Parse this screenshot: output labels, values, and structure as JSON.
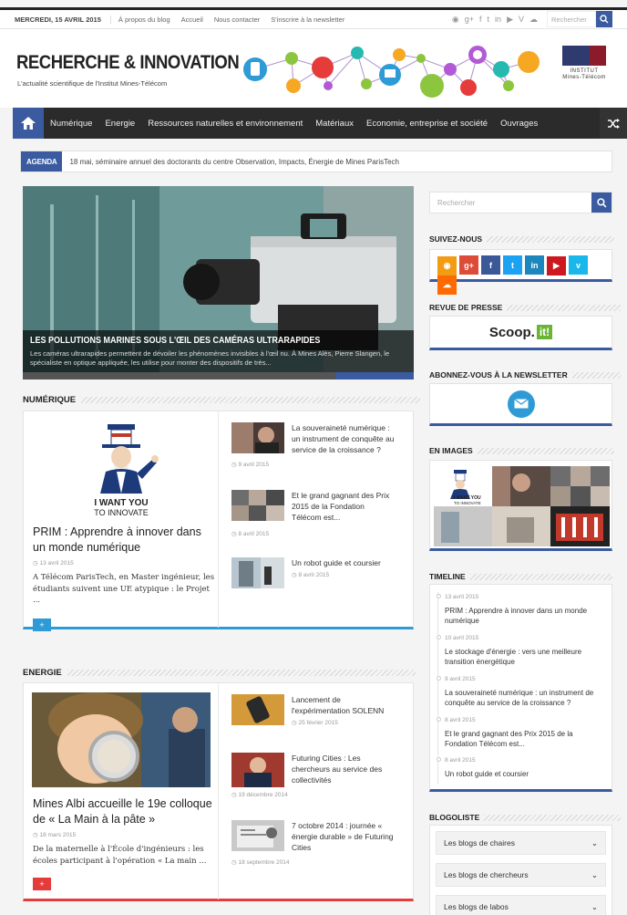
{
  "topbar": {
    "date": "MERCREDI, 15 AVRIL 2015",
    "links": [
      "À propos du blog",
      "Accueil",
      "Nous contacter",
      "S'inscrire à la newsletter"
    ],
    "search_placeholder": "Rechercher"
  },
  "header": {
    "site_title": "RECHERCHE & INNOVATION",
    "tagline": "L'actualité scientifique de l'Institut Mines-Télécom",
    "institute_logo_text": "INSTITUT\nMines-Télécom"
  },
  "nav": {
    "items": [
      "Numérique",
      "Energie",
      "Ressources naturelles et environnement",
      "Matériaux",
      "Economie, entreprise et société",
      "Ouvrages"
    ]
  },
  "ticker": {
    "tag": "AGENDA",
    "text": "18 mai, séminaire annuel des doctorants du centre Observation, Impacts, Énergie de Mines ParisTech"
  },
  "slider": {
    "title": "LES POLLUTIONS MARINES SOUS L'ŒIL DES CAMÉRAS ULTRARAPIDES",
    "text": "Les caméras ultrarapides permettent de dévoiler les phénomènes invisibles à l'œil nu. À Mines Alès, Pierre Slangen, le spécialiste en optique appliquée, les utilise pour monter des dispositifs de très..."
  },
  "numerique": {
    "section_title": "NUMÉRIQUE",
    "featured": {
      "image_line1": "I WANT YOU",
      "image_line2": "TO INNOVATE",
      "title": "PRIM : Apprendre à innover dans un monde numérique",
      "date": "13 avril 2015",
      "excerpt": "A Télécom ParisTech, en Master ingénieur, les étudiants suivent une UE atypique : le Projet ...",
      "more": "+"
    },
    "list": [
      {
        "title": "La souveraineté numérique : un instrument de conquête au service de la croissance ?",
        "date": "9 avril 2015"
      },
      {
        "title": "Et le grand gagnant des Prix 2015 de la Fondation Télécom est...",
        "date": "8 avril 2015"
      },
      {
        "title": "Un robot guide et coursier",
        "date": "8 avril 2015"
      }
    ]
  },
  "energie": {
    "section_title": "ENERGIE",
    "featured": {
      "title": "Mines Albi accueille le 19e colloque de « La Main à la pâte »",
      "date": "18 mars 2015",
      "excerpt": "De la maternelle à l'École d'ingénieurs : les écoles participant à l'opération « La main ...",
      "more": "+"
    },
    "list": [
      {
        "title": "Lancement de l'expérimentation SOLENN",
        "date": "25 février 2015"
      },
      {
        "title": "Futuring Cities : Les chercheurs au service des collectivités",
        "date": "19 décembre 2014"
      },
      {
        "title": "7 octobre 2014 : journée « énergie durable » de Futuring Cities",
        "date": "18 septembre 2014"
      }
    ]
  },
  "sidebar": {
    "search_placeholder": "Rechercher",
    "follow_title": "SUIVEZ-NOUS",
    "social": [
      {
        "icon": "rss-icon",
        "glyph": "◉",
        "color": "#f39c12"
      },
      {
        "icon": "google-plus-icon",
        "glyph": "g+",
        "color": "#dd4b39"
      },
      {
        "icon": "facebook-icon",
        "glyph": "f",
        "color": "#3b5998"
      },
      {
        "icon": "twitter-icon",
        "glyph": "t",
        "color": "#1da1f2"
      },
      {
        "icon": "linkedin-icon",
        "glyph": "in",
        "color": "#1c87bd"
      },
      {
        "icon": "youtube-icon",
        "glyph": "▶",
        "color": "#cc181e"
      },
      {
        "icon": "vimeo-icon",
        "glyph": "v",
        "color": "#1ab7ea"
      },
      {
        "icon": "soundcloud-icon",
        "glyph": "☁",
        "color": "#ff6a00"
      }
    ],
    "press_title": "REVUE DE PRESSE",
    "press_logo": "Scoop.",
    "press_logo_badge": "it!",
    "newsletter_title": "ABONNEZ-VOUS À LA NEWSLETTER",
    "images_title": "EN IMAGES",
    "images_caption_line1": "I WANT YOU",
    "images_caption_line2": "TO INNOVATE",
    "timeline_title": "TIMELINE",
    "timeline": [
      {
        "date": "13 avril 2015",
        "title": "PRIM : Apprendre à innover dans un monde numérique"
      },
      {
        "date": "10 avril 2015",
        "title": "Le stockage d'énergie : vers une meilleure transition énergétique"
      },
      {
        "date": "9 avril 2015",
        "title": "La souveraineté numérique : un instrument de conquête au service de la croissance ?"
      },
      {
        "date": "8 avril 2015",
        "title": "Et le grand gagnant des Prix 2015 de la Fondation Télécom est..."
      },
      {
        "date": "8 avril 2015",
        "title": "Un robot guide et coursier"
      }
    ],
    "blogoliste_title": "BLOGOLISTE",
    "blogs": [
      "Les blogs de chaires",
      "Les blogs de chercheurs",
      "Les blogs de labos"
    ]
  },
  "colors": {
    "accent": "#3a5ba0",
    "nav_bg": "#2b2b2b",
    "energie_accent": "#e63b3b",
    "numerique_accent": "#2e9bd6"
  }
}
